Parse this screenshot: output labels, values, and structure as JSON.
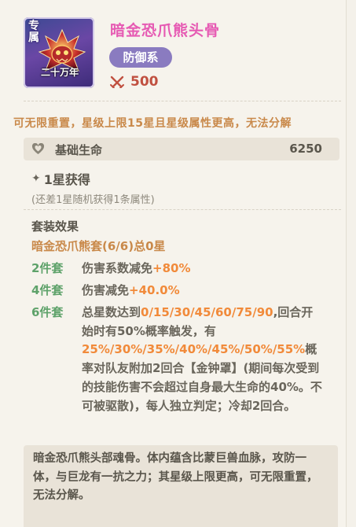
{
  "item": {
    "name": "暗金恐爪熊头骨",
    "type": "防御系",
    "power": "500",
    "icon": {
      "badge": "专属",
      "age": "二十万年",
      "depicts": "skull-icon"
    }
  },
  "notice": "可无限重置，星级上限15星且星级属性更高，无法分解",
  "base_stat": {
    "label": "基础生命",
    "value": "6250",
    "icon": "heart-icon"
  },
  "star": {
    "label": "1星获得",
    "sub": "(还差1星随机获得1条属性)"
  },
  "set": {
    "heading": "套装效果",
    "name": "暗金恐爪熊套(6/6)总0星",
    "two": {
      "label": "2件套",
      "text": "伤害系数减免",
      "value": "+80%"
    },
    "four": {
      "label": "4件套",
      "text": "伤害减免",
      "value": "+40.0%"
    },
    "six": {
      "label": "6件套",
      "t1": "总星数达到",
      "v1": "0/15/30/45/60/75/90",
      "t2": ",回合开始时有50%概率触发，有",
      "v2": "25%/30%/35%/40%/45%/50%/55%",
      "t3": "概率对队友附加2回合【金钟罩】(期间每次受到的技能伤害不会超过自身最大生命的40%。不可被驱散)，每人独立判定；冷却2回合。"
    }
  },
  "lore": "暗金恐爪熊头部魂骨。体内蕴含比蒙巨兽血脉，攻防一体，与巨龙有一抗之力；其星级上限更高，可无限重置，无法分解。",
  "colors": {
    "title": "#e65ab3",
    "type_pill": "#8a7bc0",
    "power": "#c05040",
    "set_label": "#5ea26a",
    "highlight": "#f18a3a",
    "notice": "#c9894a"
  }
}
